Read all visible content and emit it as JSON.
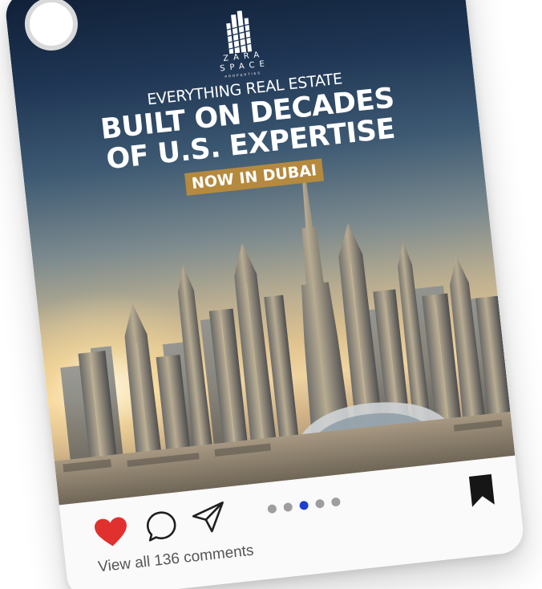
{
  "post": {
    "logo": {
      "word_line1": "ZARA",
      "word_line2": "SPACE",
      "word_sub": "PROPERTIES"
    },
    "headline": {
      "kicker": "EVERYTHING REAL ESTATE",
      "line1": "BUILT ON DECADES",
      "line2": "OF U.S. EXPERTISE",
      "tagline": "NOW IN DUBAI"
    }
  },
  "actions": {
    "like_icon": "heart-filled-icon",
    "comment_icon": "speech-bubble-icon",
    "share_icon": "paper-plane-icon",
    "save_icon": "bookmark-filled-icon",
    "liked": true,
    "carousel": {
      "total": 5,
      "active": 3
    },
    "comments_link": "View all 136 comments"
  },
  "colors": {
    "like": "#e0312e",
    "carousel_active": "#1d3fcf",
    "carousel_inactive": "#9e9e9e",
    "tagline_bg": "#b58a3e"
  }
}
